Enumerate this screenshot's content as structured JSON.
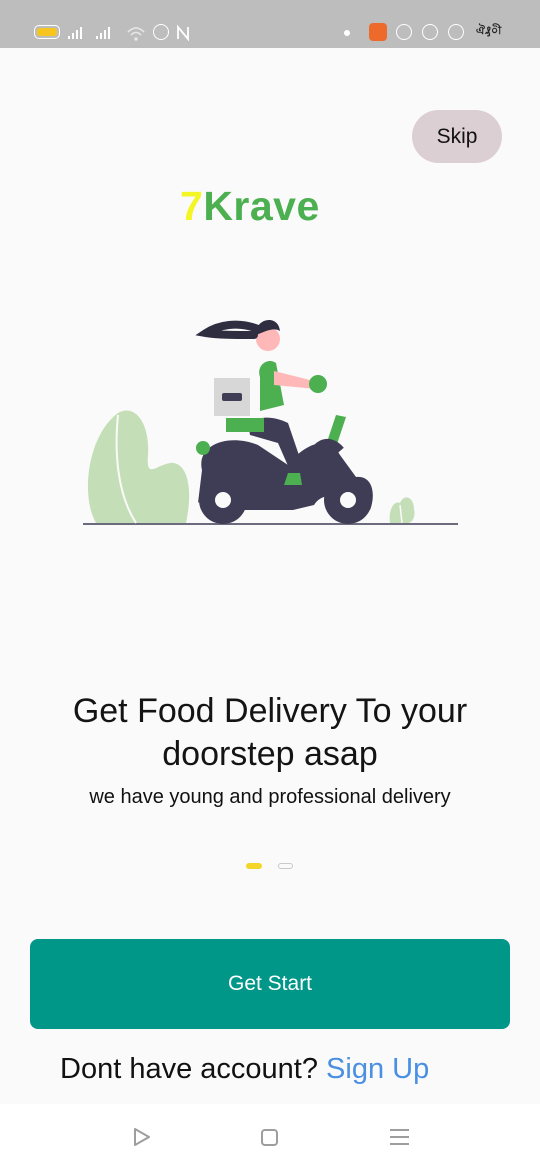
{
  "status_bar": {
    "background": "#bdbdbd",
    "battery_color": "#f7c51f",
    "icons": [
      "battery-icon",
      "signal-icon",
      "signal-icon",
      "wifi-icon",
      "alarm-icon",
      "nfc-icon",
      "dot-icon",
      "app-notification-icon",
      "facebook-icon",
      "messenger-icon",
      "notification-icon"
    ],
    "right_text": "ঐ₰০ী"
  },
  "skip": {
    "label": "Skip"
  },
  "logo": {
    "number": "7",
    "word": "Krave",
    "number_color": "#f3f525",
    "word_color": "#4caf50"
  },
  "illustration": {
    "name": "scooter-delivery-illustration"
  },
  "onboarding": {
    "title": "Get Food Delivery To your doorstep asap",
    "subtitle": "we have young and professional delivery",
    "page_count": 2,
    "active_page": 1
  },
  "cta": {
    "label": "Get Start",
    "color": "#009688"
  },
  "signup": {
    "prompt": "Dont have account?",
    "link": "Sign Up",
    "link_color": "#4a90e2"
  },
  "nav_bar": {
    "icons": [
      "back-triangle-icon",
      "home-square-icon",
      "menu-lines-icon"
    ]
  }
}
